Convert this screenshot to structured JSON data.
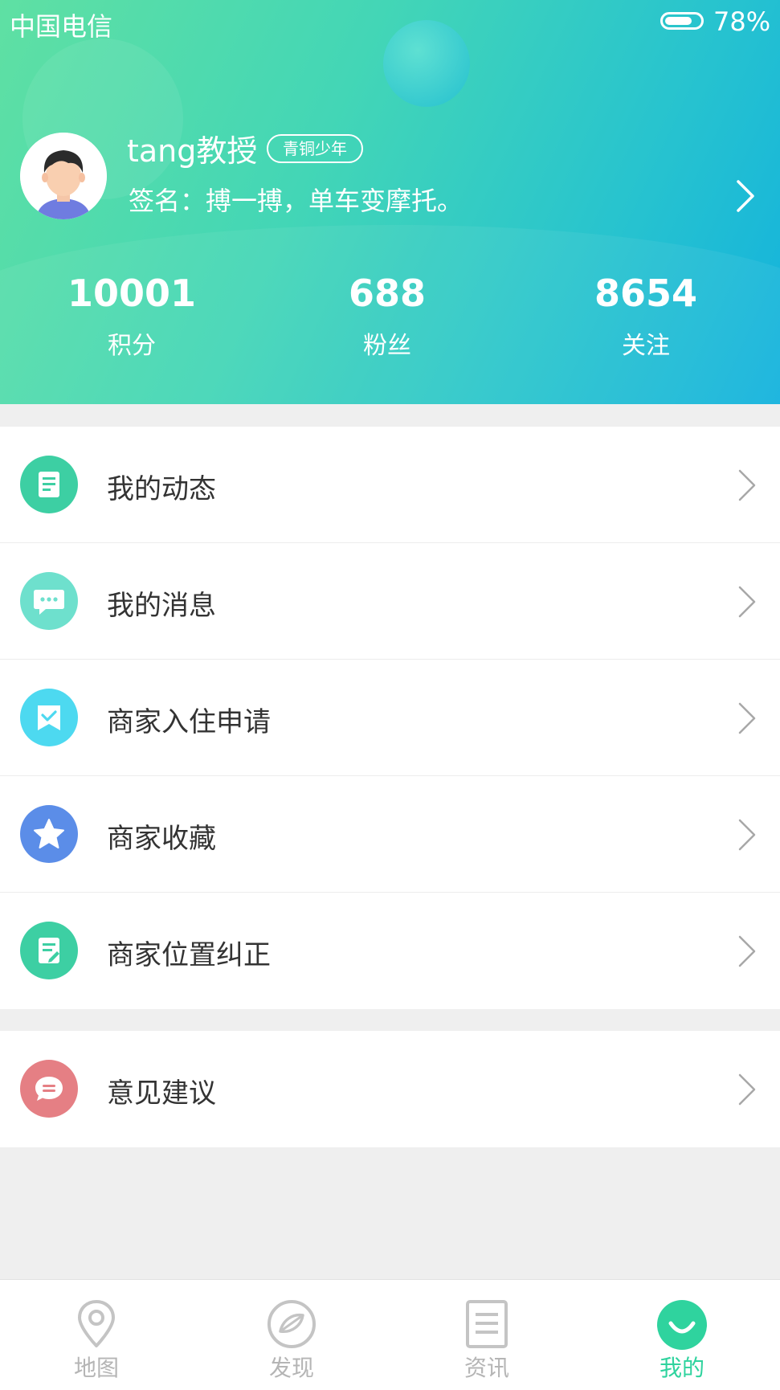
{
  "status_bar": {
    "carrier": "中国电信",
    "battery_percent": "78%",
    "battery_level": 0.78
  },
  "profile": {
    "username": "tang教授",
    "level_badge": "青铜少年",
    "signature": "签名：搏一搏，单车变摩托。"
  },
  "stats": [
    {
      "value": "10001",
      "label": "积分"
    },
    {
      "value": "688",
      "label": "粉丝"
    },
    {
      "value": "8654",
      "label": "关注"
    }
  ],
  "menu": [
    {
      "label": "我的动态",
      "icon": "document-icon",
      "color": "#3dcfa3"
    },
    {
      "label": "我的消息",
      "icon": "chat-bubble-icon",
      "color": "#6ee0cd"
    },
    {
      "label": "商家入住申请",
      "icon": "bookmark-check-icon",
      "color": "#4dd9f0"
    },
    {
      "label": "商家收藏",
      "icon": "star-icon",
      "color": "#5b8de8"
    },
    {
      "label": "商家位置纠正",
      "icon": "edit-note-icon",
      "color": "#3dcfa3"
    }
  ],
  "menu2": [
    {
      "label": "意见建议",
      "icon": "feedback-icon",
      "color": "#e57f84"
    }
  ],
  "tabbar": [
    {
      "label": "地图",
      "icon": "location-pin-icon"
    },
    {
      "label": "发现",
      "icon": "compass-icon"
    },
    {
      "label": "资讯",
      "icon": "news-icon"
    },
    {
      "label": "我的",
      "icon": "smile-icon",
      "active": true
    }
  ],
  "colors": {
    "accent": "#2fd39e",
    "header_start": "#5fe0a3",
    "header_end": "#13b2dd"
  }
}
